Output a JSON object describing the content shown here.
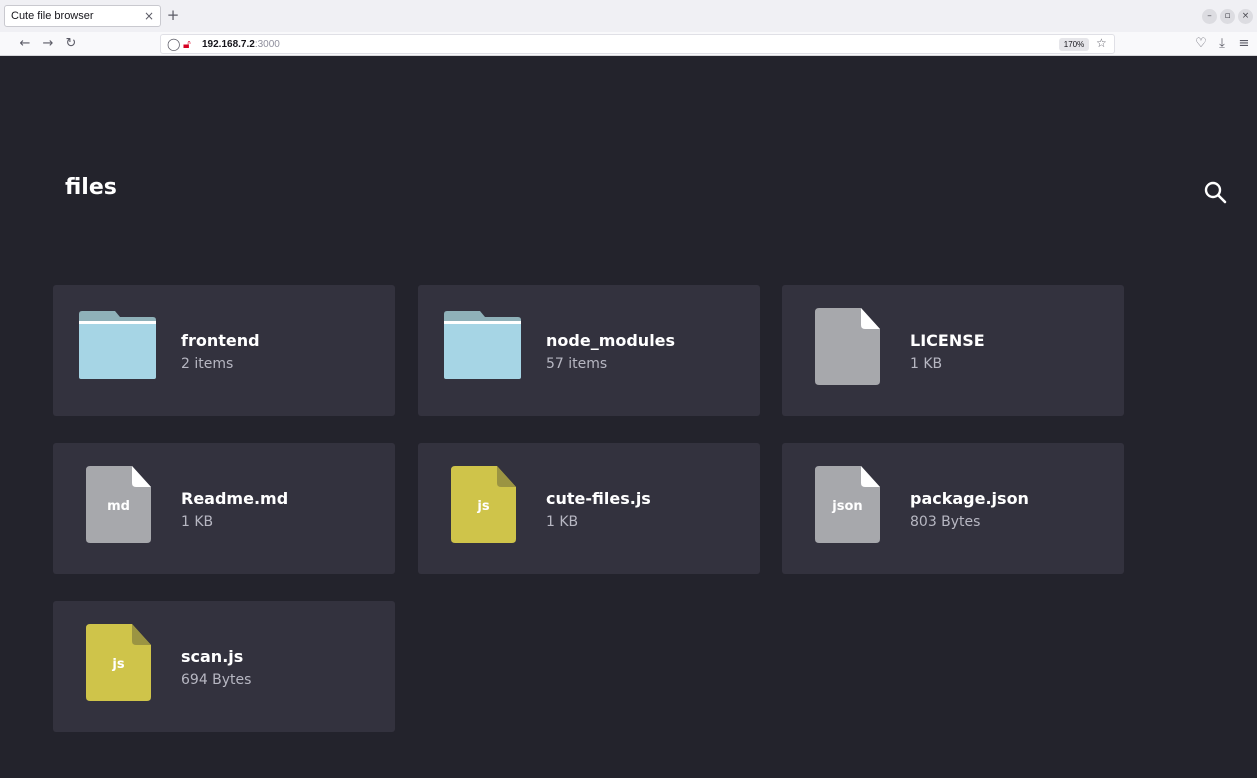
{
  "browser": {
    "tab_title": "Cute file browser",
    "tab_close": "×",
    "new_tab": "+",
    "url_host": "192.168.7.2",
    "url_port": ":3000",
    "zoom": "170%"
  },
  "app": {
    "title": "files",
    "items": [
      {
        "name": "frontend",
        "meta": "2 items",
        "kind": "folder"
      },
      {
        "name": "node_modules",
        "meta": "57 items",
        "kind": "folder"
      },
      {
        "name": "LICENSE",
        "meta": "1 KB",
        "kind": "file"
      },
      {
        "name": "Readme.md",
        "meta": "1 KB",
        "kind": "file",
        "ext": "md"
      },
      {
        "name": "cute-files.js",
        "meta": "1 KB",
        "kind": "file",
        "ext": "js"
      },
      {
        "name": "package.json",
        "meta": "803 Bytes",
        "kind": "file",
        "ext": "json"
      },
      {
        "name": "scan.js",
        "meta": "694 Bytes",
        "kind": "file",
        "ext": "js"
      }
    ]
  },
  "colors": {
    "background": "#23232c",
    "card": "#33323e",
    "folder": "#a6d5e5",
    "file_generic": "#a7a8ac",
    "file_js": "#cfc44a"
  }
}
